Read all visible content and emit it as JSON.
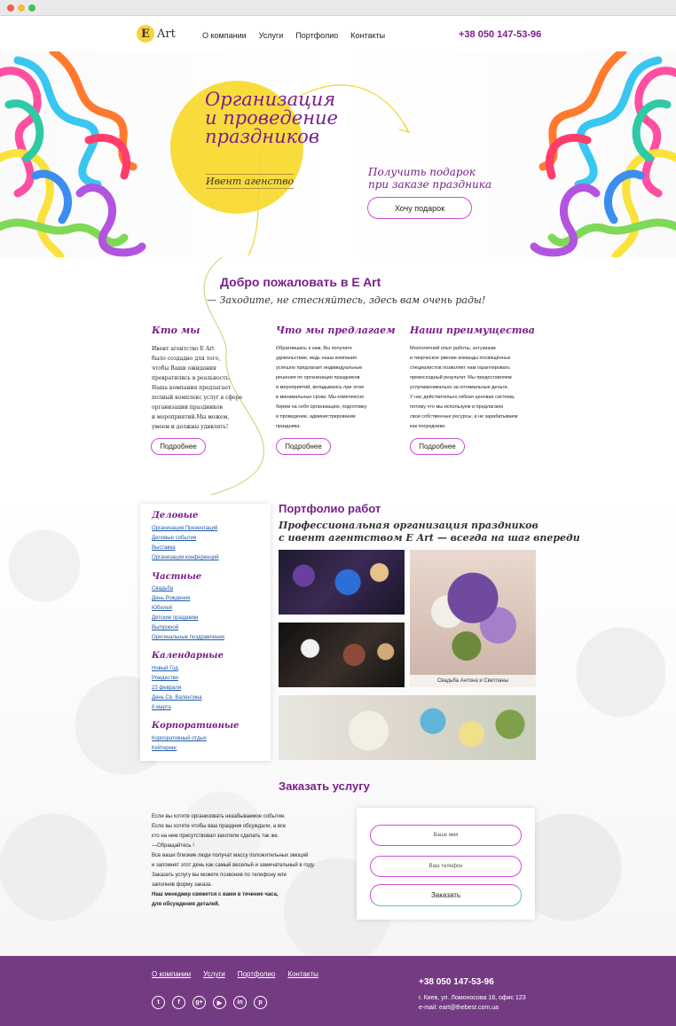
{
  "header": {
    "logo_letter": "E",
    "logo_text": "Art",
    "nav": [
      "О компании",
      "Услуги",
      "Портфолио",
      "Контакты"
    ],
    "phone": "+38 050 147-53-96"
  },
  "hero": {
    "title": "Организация и проведение праздников",
    "subtitle": "Ивент агенство",
    "gift_line1": "Получить подарок",
    "gift_line2": "при заказе праздника",
    "gift_button": "Хочу подарок"
  },
  "welcome": {
    "title": "Добро пожаловать в E Art",
    "subtitle": "— Заходите, не стесняйтесь, здесь вам очень рады!"
  },
  "columns": [
    {
      "title": "Кто мы",
      "lines": [
        "Ивент агентство E Art",
        "было создадно для того,",
        "чтобы Ваши ожидания",
        "превратились в реальность.",
        "Наша компания предлагает",
        "полный комплекс услуг в сфере",
        "организации праздников",
        "и мероприятий.Мы можем,",
        "умеем и должны удивлять!"
      ],
      "button": "Подробнее"
    },
    {
      "title": "Что мы предлагаем",
      "lines": [
        "Обратившись к нам, Вы получите",
        "удовольствие, ведь наша компания",
        "успешно предлагает индивидуальные",
        "решения по организации праздников",
        "и мероприятий, вкладываясь при этом",
        "в минимальные сроки. Мы комплексно",
        "берем на себя организацию, подготовку",
        "и проведение, администрирование",
        "праздника."
      ],
      "button": "Подробнее"
    },
    {
      "title": "Наши преимущества",
      "lines": [
        "Многолетний опыт работы, энтузиазм",
        "и творческое рвение команды посвящённых",
        "специалистов позволяет нам гарантировать",
        "превосходный результат. Мы предоставляем",
        "услугмаксимально за оптимальные деньги.",
        "У нас действительно гибкая ценовая система,",
        "потому что мы используем и предлагаем",
        "свои собственные ресурсы, а не зарабатываем",
        "как посредники."
      ],
      "button": "Подробнее"
    }
  ],
  "sidebar": {
    "categories": [
      {
        "name": "Деловые",
        "links": [
          "Организация Презентаций",
          "Деловые события",
          "Выставка",
          "Организация конференций"
        ]
      },
      {
        "name": "Частные",
        "links": [
          "Свадьба",
          "День Рождения",
          "Юбилей",
          "Детские праздники",
          "Выпускной",
          "Оригинальные поздравления"
        ]
      },
      {
        "name": "Календарные",
        "links": [
          "Новый Год",
          "Рождество",
          "23 февраля",
          "День Св. Валентина",
          "8 марта"
        ]
      },
      {
        "name": "Корпоративные",
        "links": [
          "Корпоративный отдых",
          "Кейтеринг"
        ]
      }
    ]
  },
  "portfolio": {
    "title": "Портфолио работ",
    "subtitle_line1": "Профессиональная организация праздников",
    "subtitle_line2": "с ивент агентством E Art — всегда на шаг впереди",
    "caption": "Свадьба Антона и Светланы"
  },
  "order": {
    "title": "Заказать услугу",
    "lines": [
      "Если вы хотите организовать незабываемое событие.",
      "Если вы хотите чтобы ваш праздник обсуждали, а все",
      "кто на нем присутствовал захотели сделать так же.",
      "—Обращайтесь !",
      "Все ваши близкие люди получат массу положительных эмоций",
      "и запомнят этот день как самый веселый и замечательный в году.",
      "Заказать услугу вы можете позвонив по телефону или",
      "заполнив форму заказа."
    ],
    "bold_line1": "Наш менеджер свяжется с вами в течение часа,",
    "bold_line2": "для обсуждения деталей.",
    "name_placeholder": "Ваше имя",
    "phone_placeholder": "Ваш телефон",
    "submit": "Заказать"
  },
  "footer": {
    "nav": [
      "О компании",
      "Услуги",
      "Портфолио",
      "Контакты"
    ],
    "socials": [
      "twitter-icon",
      "facebook-icon",
      "google-plus-icon",
      "youtube-icon",
      "linkedin-icon",
      "pinterest-icon"
    ],
    "phone": "+38 050 147-53-96",
    "address": "г. Киев,  ул. Ломоносова 18, офис 123",
    "email": "e-mail: eart@thebest.com.ua"
  },
  "colors": {
    "accent": "#7a1f8b",
    "yellow": "#f8dc3c",
    "footer": "#743b83",
    "button_border": "#c94fd3"
  }
}
